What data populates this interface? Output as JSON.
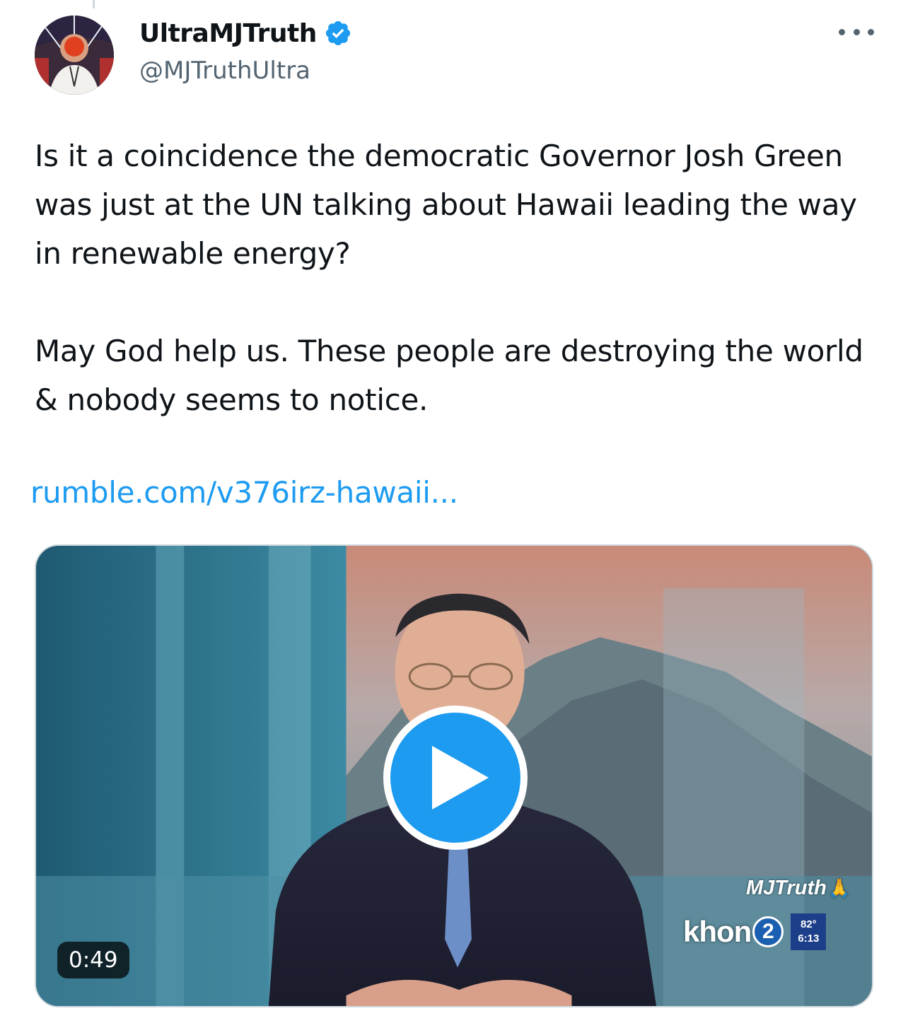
{
  "author": {
    "display_name": "UltraMJTruth",
    "handle": "@MJTruthUltra",
    "verified": true,
    "verified_color": "#1d9bf0"
  },
  "more_icon": "more-horizontal-icon",
  "tweet": {
    "paragraphs": [
      "Is it a coincidence the democratic Governor Josh Green was just at the UN talking about Hawaii leading the way in renewable energy?",
      "May God help us. These people are destroying the world & nobody seems to notice."
    ],
    "link_text": "rumble.com/v376irz-hawaii..."
  },
  "video": {
    "duration": "0:49",
    "play_icon": "play-icon",
    "overlay": {
      "watermark": "MJTruth",
      "watermark_emoji": "🙏",
      "station_name": "khon",
      "station_number": "2",
      "temperature": "82°",
      "time": "6:13"
    }
  },
  "colors": {
    "text": "#0f1419",
    "secondary": "#536471",
    "link": "#1d9bf0",
    "play_button": "#1d9bf0"
  }
}
